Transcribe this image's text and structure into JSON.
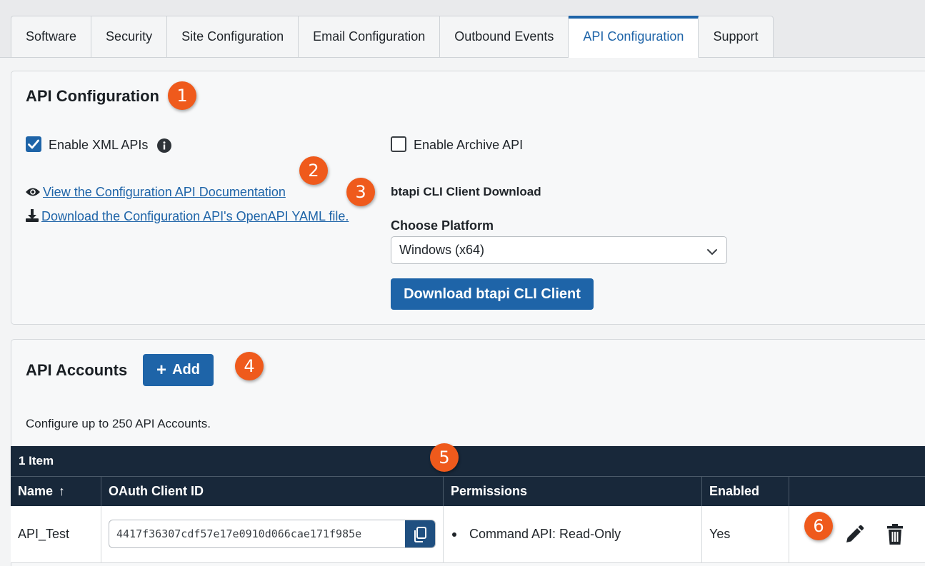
{
  "tabs": [
    {
      "label": "Software"
    },
    {
      "label": "Security"
    },
    {
      "label": "Site Configuration"
    },
    {
      "label": "Email Configuration"
    },
    {
      "label": "Outbound Events"
    },
    {
      "label": "API Configuration",
      "active": true
    },
    {
      "label": "Support"
    }
  ],
  "api_config": {
    "title": "API Configuration",
    "enable_xml_label": "Enable XML APIs",
    "enable_xml_checked": true,
    "enable_archive_label": "Enable Archive API",
    "enable_archive_checked": false,
    "doc_link": "View the Configuration API Documentation",
    "yaml_link": "Download the Configuration API's OpenAPI YAML file.",
    "cli_title": "btapi CLI Client Download",
    "platform_label": "Choose Platform",
    "platform_value": "Windows (x64)",
    "download_button": "Download btapi CLI Client"
  },
  "accounts": {
    "title": "API Accounts",
    "add_button": "Add",
    "description": "Configure up to 250 API Accounts.",
    "item_count": "1 Item",
    "columns": [
      "Name",
      "OAuth Client ID",
      "Permissions",
      "Enabled",
      ""
    ],
    "sort_indicator": "↑",
    "rows": [
      {
        "name": "API_Test",
        "client_id": "4417f36307cdf57e17e0910d066cae171f985e",
        "permission": "Command API: Read-Only",
        "enabled": "Yes"
      }
    ]
  },
  "callouts": [
    "1",
    "2",
    "3",
    "4",
    "5",
    "6"
  ],
  "colors": {
    "accent": "#1e64a8",
    "callout": "#ef5a1c",
    "table_header": "#18283a"
  },
  "icons": {
    "info": "info-icon",
    "eye": "eye-icon",
    "download": "download-icon",
    "chevron": "chevron-down-icon",
    "copy": "copy-icon",
    "edit": "pencil-icon",
    "delete": "trash-icon"
  }
}
